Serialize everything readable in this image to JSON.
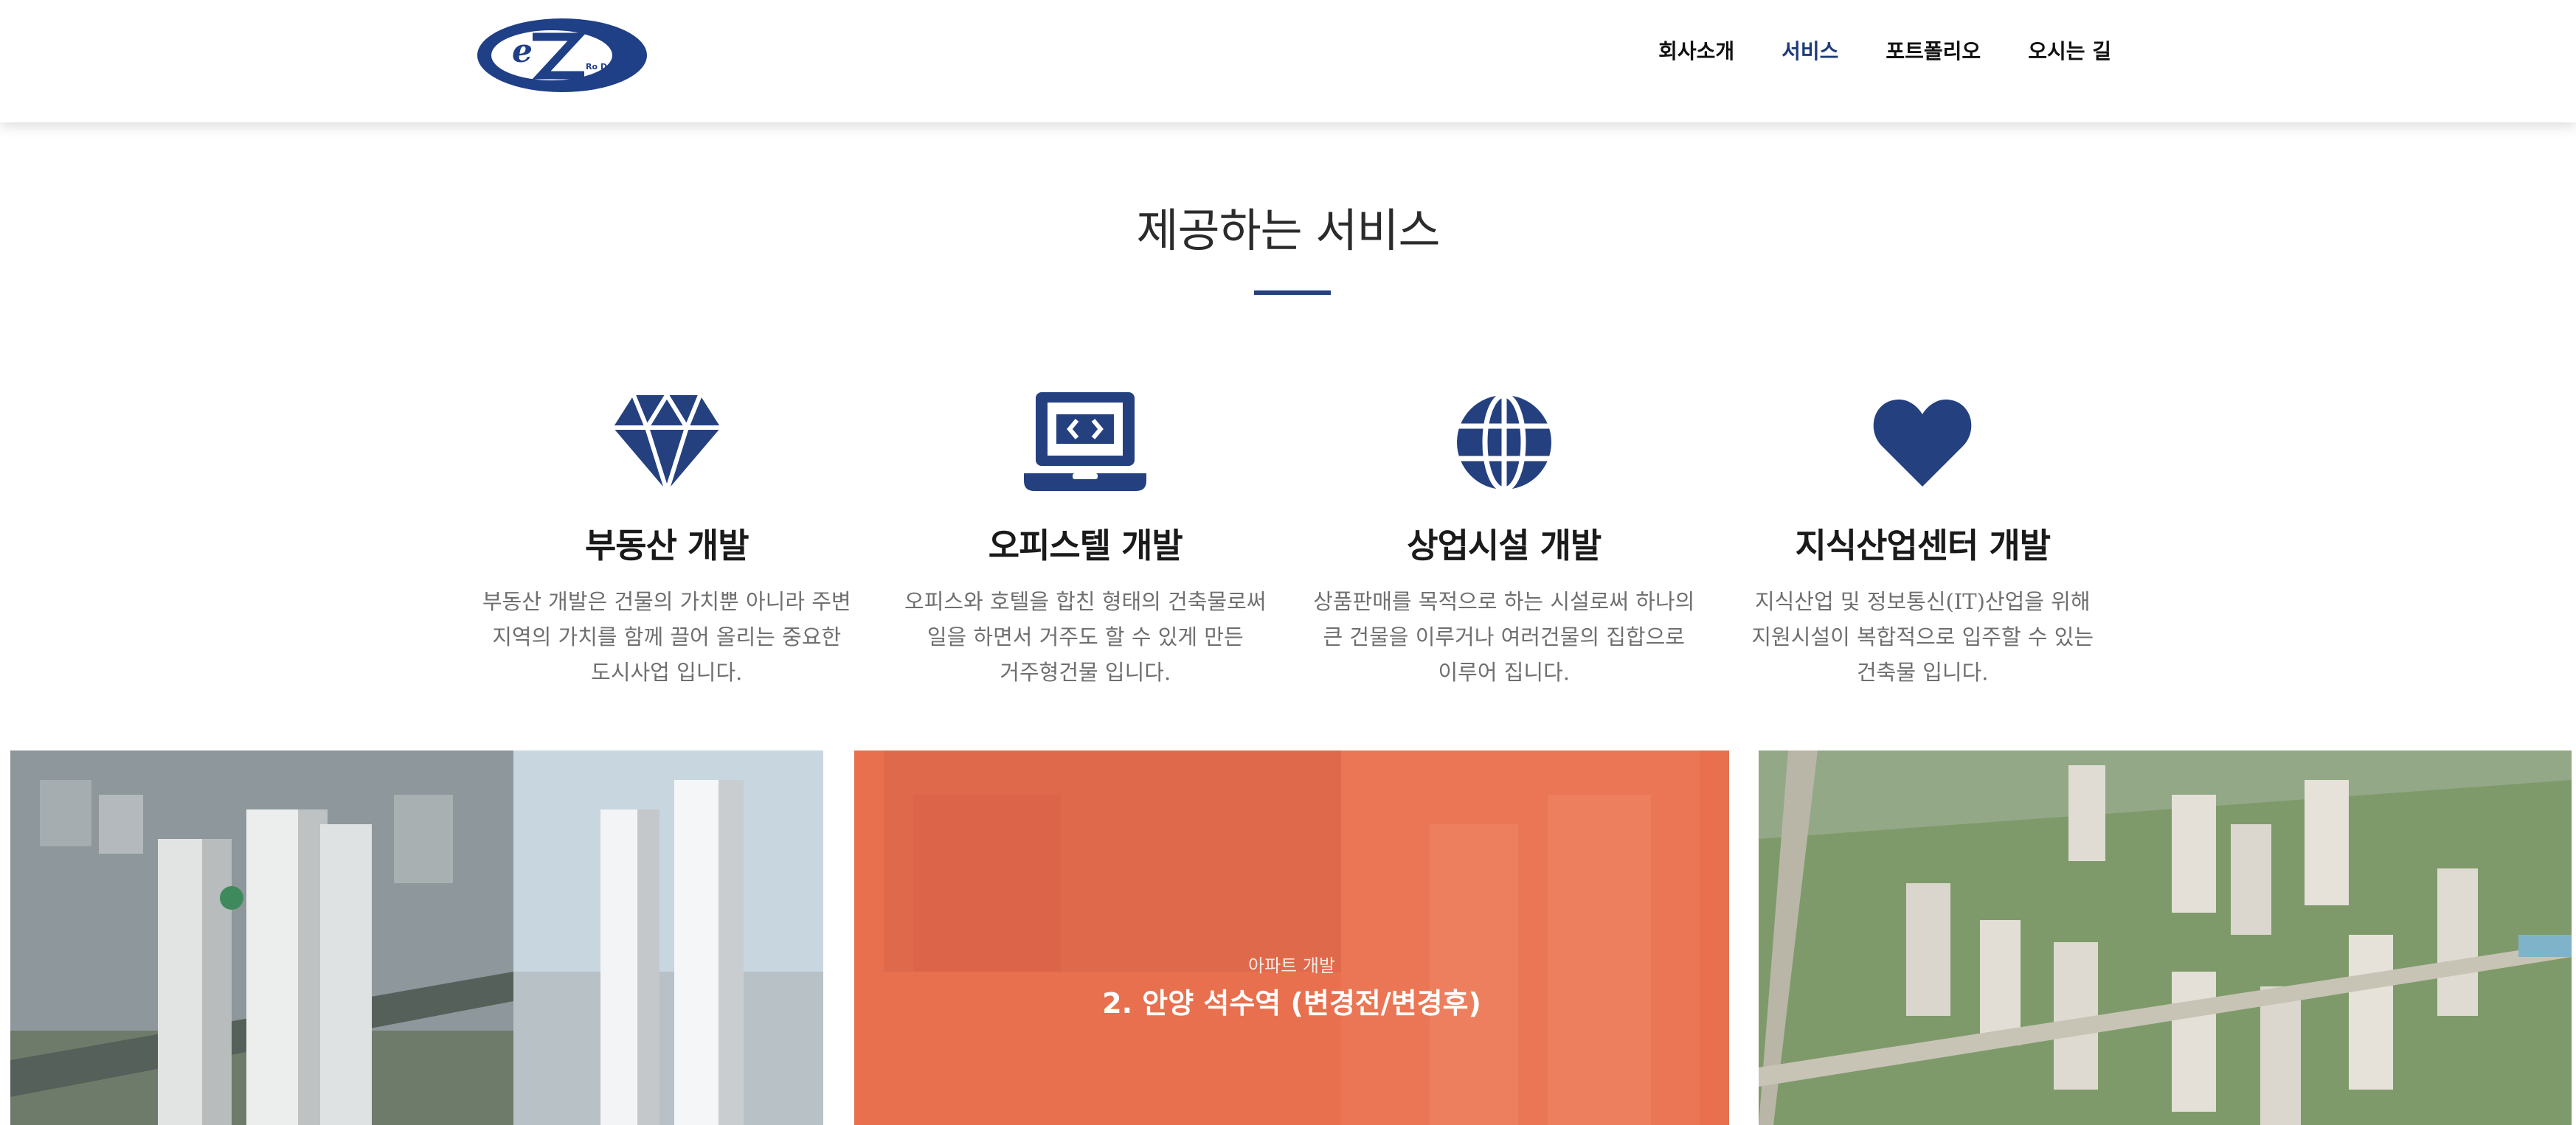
{
  "header": {
    "logo_text": "eZ",
    "logo_subtext": "Ro D&C",
    "nav": [
      {
        "label": "회사소개",
        "active": false
      },
      {
        "label": "서비스",
        "active": true
      },
      {
        "label": "포트폴리오",
        "active": false
      },
      {
        "label": "오시는 길",
        "active": false
      }
    ]
  },
  "section": {
    "title": "제공하는 서비스"
  },
  "services": [
    {
      "icon": "diamond-icon",
      "title": "부동산 개발",
      "description": "부동산 개발은 건물의 가치뿐 아니라 주변 지역의 가치를 함께 끌어 올리는 중요한 도시사업 입니다."
    },
    {
      "icon": "laptop-code-icon",
      "title": "오피스텔 개발",
      "description": "오피스와 호텔을 합친 형태의 건축물로써 일을 하면서 거주도 할 수 있게 만든 거주형건물 입니다."
    },
    {
      "icon": "globe-icon",
      "title": "상업시설 개발",
      "description": "상품판매를 목적으로 하는 시설로써 하나의 큰 건물을 이루거나 여러건물의 집합으로 이루어 집니다."
    },
    {
      "icon": "heart-icon",
      "title": "지식산업센터 개발",
      "description": "지식산업 및 정보통신(IT)산업을 위해 지원시설이 복합적으로 입주할 수 있는 건축물 입니다."
    }
  ],
  "portfolio": {
    "featured": {
      "category": "아파트 개발",
      "title": "2. 안양 석수역 (변경전/변경후)"
    }
  },
  "colors": {
    "brand": "#24407f",
    "overlay": "#e8704f"
  }
}
